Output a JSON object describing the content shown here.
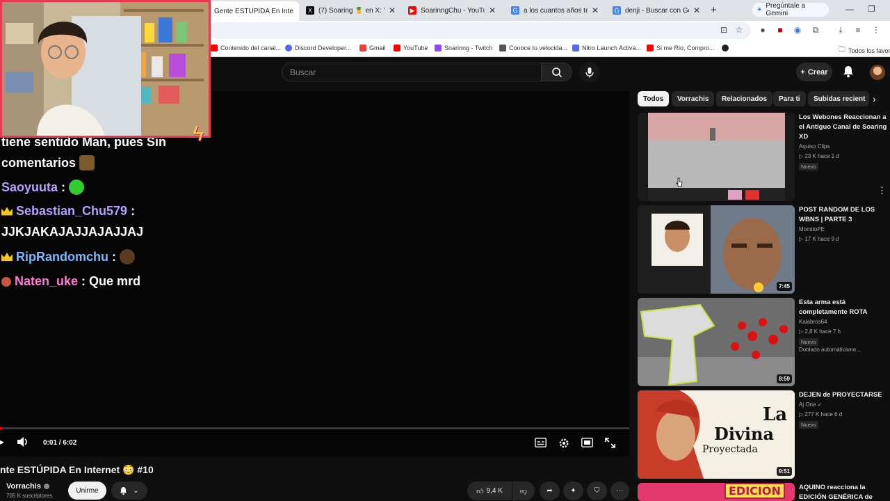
{
  "browser": {
    "tabs": [
      {
        "label": "Gente ESTÚPIDA En Intern",
        "favicon_color": "#ff0000",
        "active": true
      },
      {
        "label": "(7) Soaring 🍍 en X: \"Cor",
        "favicon_color": "#000000"
      },
      {
        "label": "SoarinngChu - YouTube",
        "favicon_color": "#ff0000"
      },
      {
        "label": "a los cuantos años te emp",
        "favicon_color": "#4285f4"
      },
      {
        "label": "denji - Buscar con Google",
        "favicon_color": "#4285f4"
      }
    ],
    "gemini_label": "Pregúntale a Gemini",
    "bookmarks": [
      {
        "label": "Contenido del canal...",
        "color": "#ff0000"
      },
      {
        "label": "Discord Developer...",
        "color": "#5865f2"
      },
      {
        "label": "Gmail",
        "color": "#ea4335"
      },
      {
        "label": "YouTube",
        "color": "#ff0000"
      },
      {
        "label": "Soarinng - Twitch",
        "color": "#9146ff"
      },
      {
        "label": "Conoce tu velocida...",
        "color": "#555555"
      },
      {
        "label": "Nitro Launch Activa...",
        "color": "#5865f2"
      },
      {
        "label": "Si me Rio, Compro...",
        "color": "#ff0000"
      },
      {
        "label": "Todos los favori",
        "color": "#777777"
      }
    ]
  },
  "youtube": {
    "search_placeholder": "Buscar",
    "create_label": "Crear",
    "player": {
      "time": "0:01 / 6:02",
      "progress": 0.003
    },
    "chat": [
      {
        "user": "",
        "message": "tiene sentido Man, pues Sin",
        "color": "#ffffff"
      },
      {
        "user": "",
        "message": "comentarios",
        "color": "#ffffff"
      },
      {
        "user": "Saoyuuta",
        "message": ":",
        "color": "#b9a0ff"
      },
      {
        "user": "Sebastian_Chu579",
        "message": ":",
        "color": "#b9a0ff"
      },
      {
        "user": "",
        "message": "JJKJAKAJAJJAJAJJAJ",
        "color": "#ffffff"
      },
      {
        "user": "RipRandomchu",
        "message": ":",
        "color": "#7ab8ff"
      },
      {
        "user": "Naten_uke",
        "message": ": Que mrd",
        "color": "#ff7ad9"
      }
    ],
    "video_title": "nte ESTÚPIDA En Internet 😳 #10",
    "channel": {
      "name": "Vorrachis",
      "subscribers": "705 K suscriptores"
    },
    "join_label": "Unirme",
    "likes": "9,4 K",
    "chips": [
      "Todos",
      "Vorrachis",
      "Relacionados",
      "Para ti",
      "Subidas recient"
    ],
    "recommendations": [
      {
        "title": "Los Webones Reaccionan a el Antiguo Canal de Soaring XD",
        "channel": "Aquiso Clips",
        "meta": "▷ 23 K  hace 1 d",
        "badge": "Nuevo",
        "duration": ""
      },
      {
        "title": "POST RANDOM DE LOS WBNS | PARTE 3",
        "channel": "MomitoPE",
        "meta": "▷ 17 K  hace 9 d",
        "badge": "",
        "duration": "7:45"
      },
      {
        "title": "Esta arma está completamente ROTA",
        "channel": "Kalabros64",
        "meta": "▷ 2,8 K  hace 7 h",
        "badge": "Nuevo",
        "dub": "Doblado automáticame...",
        "duration": "8:59"
      },
      {
        "title": "DEJEN de PROYECTARSE",
        "channel": "Aj One ✓",
        "meta": "▷ 277 K  hace 6 d",
        "badge": "Nuevo",
        "duration": "9:51"
      },
      {
        "title": "AQUINO reacciona la EDICIÓN GENÉRICA de",
        "channel": "",
        "meta": "",
        "badge": "",
        "duration": ""
      }
    ],
    "thumb_text": {
      "la_divina_1": "La",
      "la_divina_2": "Divina",
      "la_divina_3": "Proyectada",
      "edicion": "EDICION"
    }
  }
}
